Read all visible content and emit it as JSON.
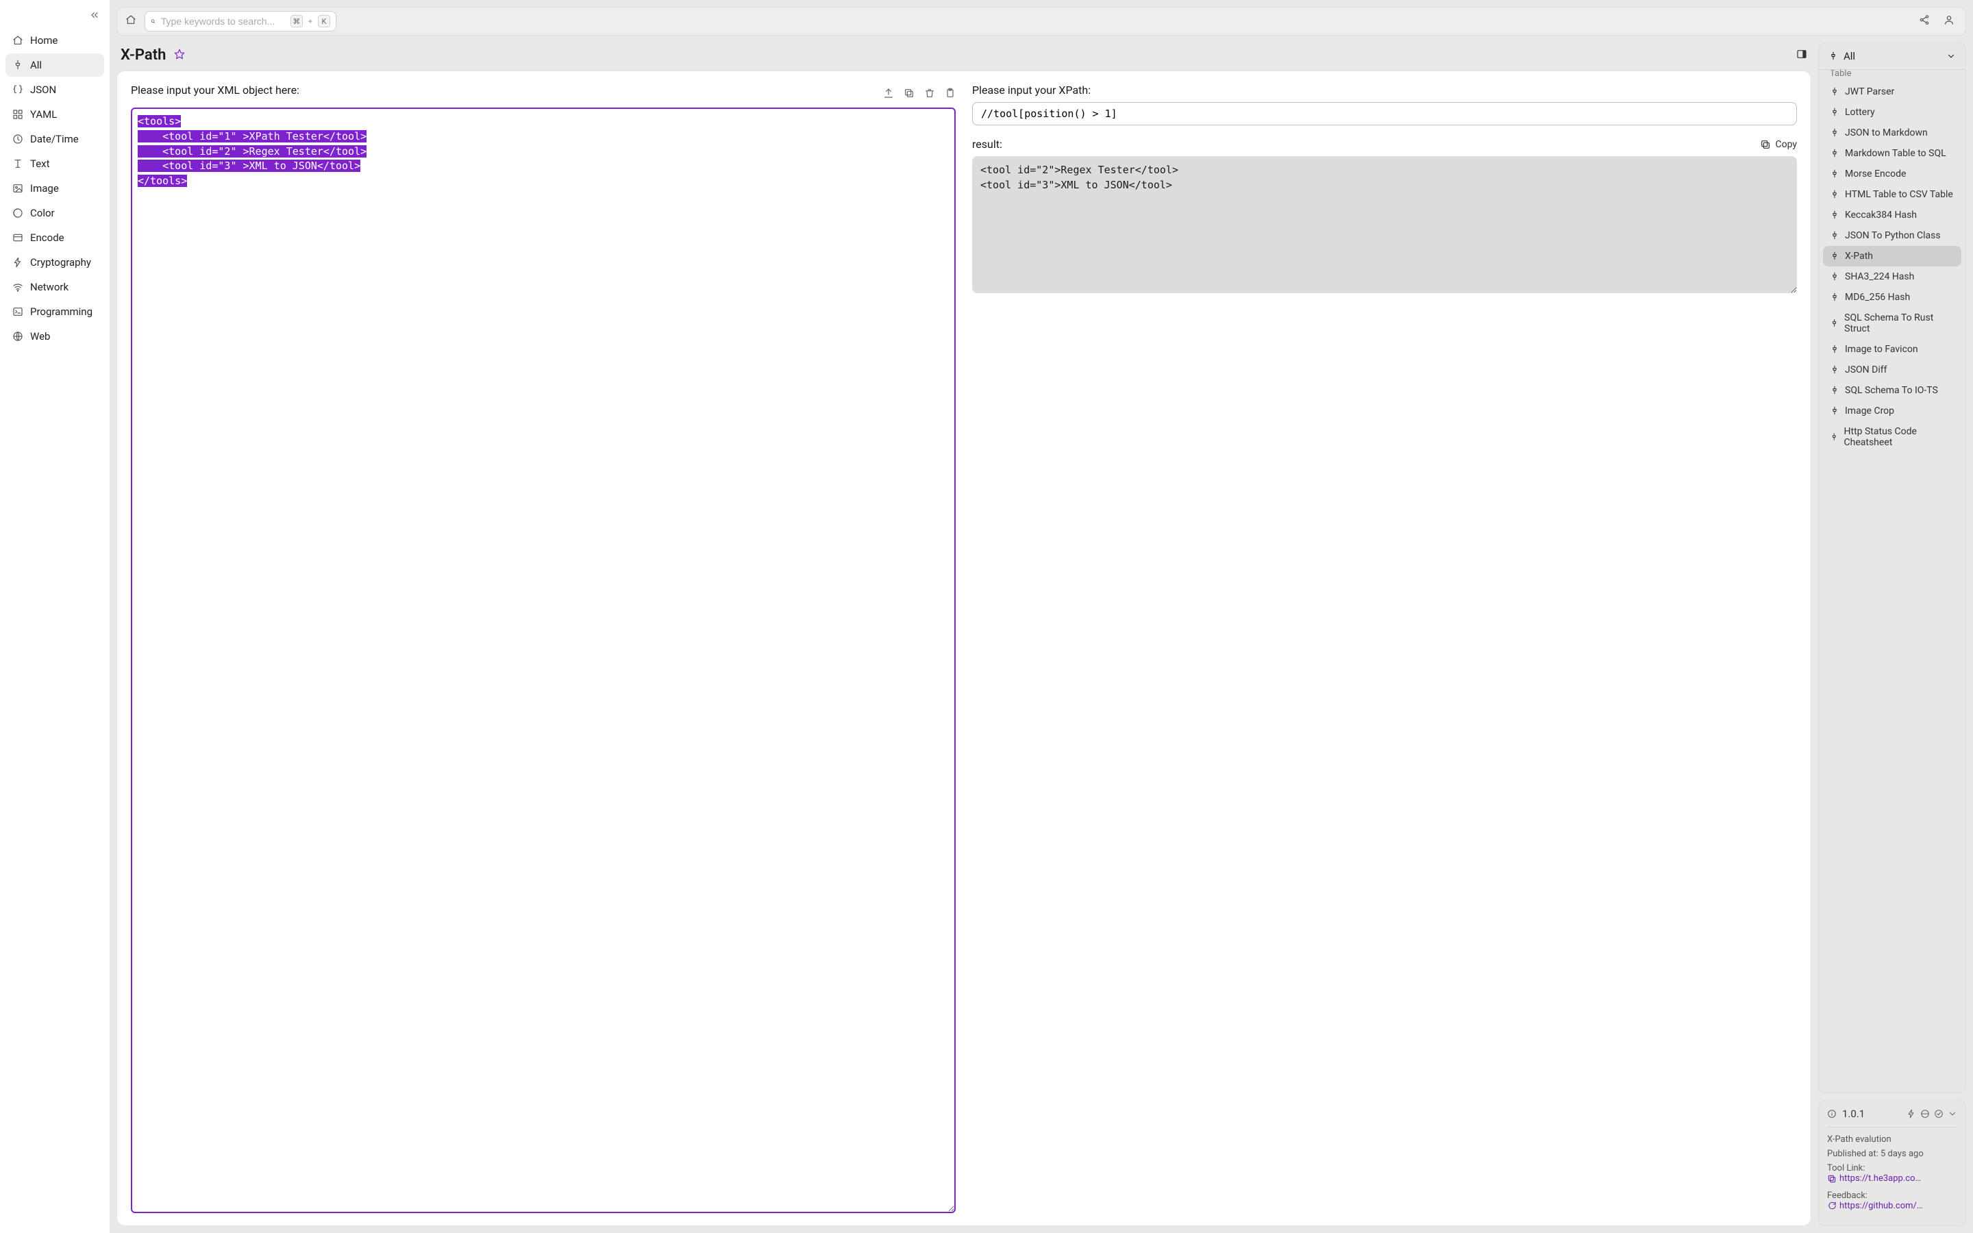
{
  "sidebar": {
    "items": [
      {
        "label": "Home",
        "icon": "home"
      },
      {
        "label": "All",
        "icon": "pin",
        "active": true
      },
      {
        "label": "JSON",
        "icon": "braces"
      },
      {
        "label": "YAML",
        "icon": "grid"
      },
      {
        "label": "Date/Time",
        "icon": "clock"
      },
      {
        "label": "Text",
        "icon": "text"
      },
      {
        "label": "Image",
        "icon": "image"
      },
      {
        "label": "Color",
        "icon": "color"
      },
      {
        "label": "Encode",
        "icon": "encode"
      },
      {
        "label": "Cryptography",
        "icon": "bolt"
      },
      {
        "label": "Network",
        "icon": "wifi"
      },
      {
        "label": "Programming",
        "icon": "terminal"
      },
      {
        "label": "Web",
        "icon": "globe"
      }
    ]
  },
  "topbar": {
    "search_placeholder": "Type keywords to search...",
    "shortcut_sep": "+",
    "shortcut_cmd": "⌘",
    "shortcut_key": "K"
  },
  "page": {
    "title": "X-Path",
    "xml_label": "Please input your XML object here:",
    "xpath_label": "Please input your XPath:",
    "result_label": "result:",
    "copy_label": "Copy",
    "xml_lines": [
      "<tools>",
      "    <tool id=\"1\" >XPath Tester</tool>",
      "    <tool id=\"2\" >Regex Tester</tool>",
      "    <tool id=\"3\" >XML to JSON</tool>",
      "</tools>"
    ],
    "xpath_value": "//tool[position() > 1]",
    "result_lines": [
      "<tool id=\"2\">Regex Tester</tool>",
      "<tool id=\"3\">XML to JSON</tool>"
    ]
  },
  "rightPanel": {
    "filter_label": "All",
    "top_cut": "Table",
    "tools": [
      {
        "label": "JWT Parser"
      },
      {
        "label": "Lottery"
      },
      {
        "label": "JSON to Markdown"
      },
      {
        "label": "Markdown Table to SQL"
      },
      {
        "label": "Morse Encode"
      },
      {
        "label": "HTML Table to CSV Table"
      },
      {
        "label": "Keccak384 Hash"
      },
      {
        "label": "JSON To Python Class"
      },
      {
        "label": "X-Path",
        "active": true
      },
      {
        "label": "SHA3_224 Hash"
      },
      {
        "label": "MD6_256 Hash"
      },
      {
        "label": "SQL Schema To Rust Struct"
      },
      {
        "label": "Image to Favicon"
      },
      {
        "label": "JSON Diff"
      },
      {
        "label": "SQL Schema To IO-TS"
      },
      {
        "label": "Image Crop"
      },
      {
        "label": "Http Status Code Cheatsheet"
      }
    ]
  },
  "info": {
    "version": "1.0.1",
    "desc": "X-Path evalution",
    "published_label": "Published at:",
    "published_value": "5 days ago",
    "tool_link_label": "Tool Link:",
    "tool_link_url": "https://t.he3app.co…",
    "feedback_label": "Feedback:",
    "feedback_url": "https://github.com/…"
  }
}
